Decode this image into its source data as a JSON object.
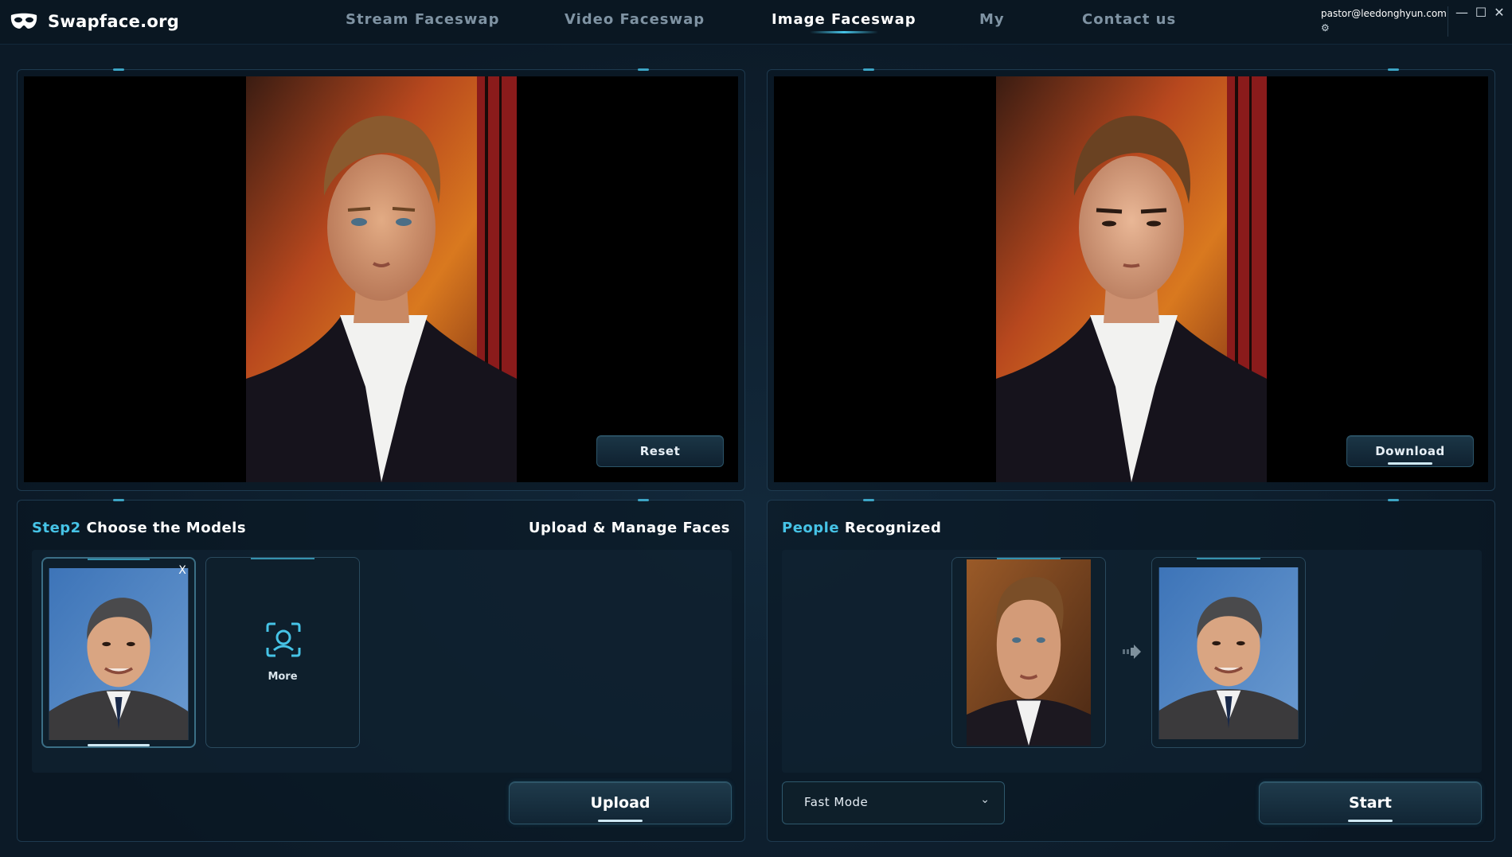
{
  "app": {
    "brand_name": "Swapface.org",
    "brand_icon": "mask-icon"
  },
  "nav": {
    "items": [
      {
        "label": "Stream Faceswap",
        "active": false
      },
      {
        "label": "Video Faceswap",
        "active": false
      },
      {
        "label": "Image Faceswap",
        "active": true
      },
      {
        "label": "My",
        "active": false
      },
      {
        "label": "Contact us",
        "active": false
      }
    ]
  },
  "user": {
    "email": "pastor@leedonghyun.com",
    "settings_icon": "gear-icon"
  },
  "window_controls": {
    "minimize": "—",
    "maximize": "☐",
    "close": "✕"
  },
  "viewers": {
    "source": {
      "reset_label": "Reset"
    },
    "result": {
      "download_label": "Download"
    }
  },
  "models_panel": {
    "title_highlight": "Step2",
    "title_rest": "Choose the Models",
    "right_title": "Upload & Manage Faces",
    "close_symbol": "X",
    "more_label": "More",
    "upload_label": "Upload"
  },
  "people_panel": {
    "title_highlight": "People",
    "title_rest": "Recognized",
    "mode_value": "Fast Mode",
    "mode_chevron": "⌄",
    "start_label": "Start"
  },
  "colors": {
    "accent": "#46c3e6",
    "background": "#0d1b28",
    "nav_inactive": "#7f93a3"
  }
}
